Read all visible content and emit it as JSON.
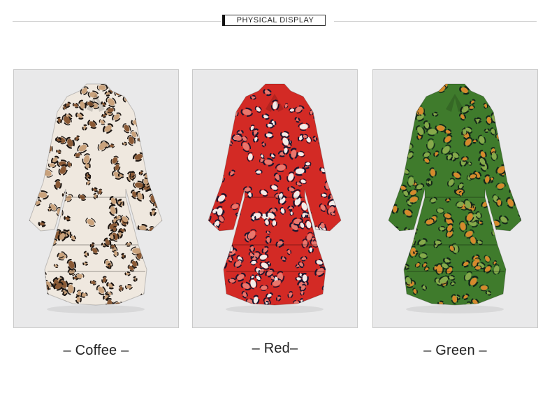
{
  "header": {
    "title": "PHYSICAL DISPLAY"
  },
  "products": [
    {
      "caption": "– Coffee –",
      "image_icon": "leopard-dress-coffee",
      "colors": {
        "base": "#efe8df",
        "spot_dark": "#1d1612",
        "spot_mid": "#8a5a36",
        "spot_light": "#c9a27c"
      }
    },
    {
      "caption": "– Red–",
      "image_icon": "leopard-dress-red",
      "colors": {
        "base": "#d32a25",
        "spot_dark": "#1b1630",
        "spot_mid": "#f1ece9",
        "spot_light": "#e8766d"
      }
    },
    {
      "caption": "– Green –",
      "image_icon": "leopard-dress-green",
      "colors": {
        "base": "#3f7b2c",
        "spot_dark": "#14251a",
        "spot_mid": "#d5892d",
        "spot_light": "#86a94b"
      }
    }
  ],
  "colors": {
    "panel_background": "#e9e9ea",
    "panel_border": "#c9c9c9",
    "divider": "#cfcfcf"
  }
}
